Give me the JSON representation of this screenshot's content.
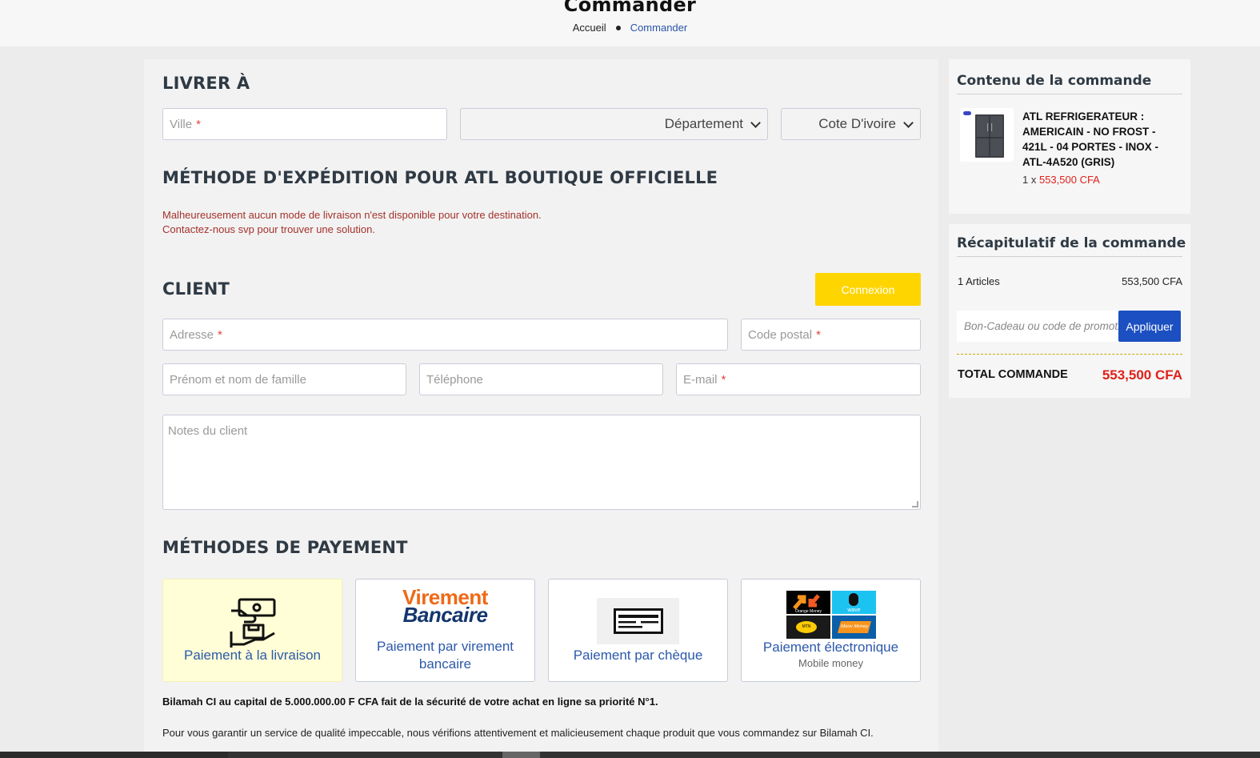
{
  "page": {
    "title": "Commander",
    "breadcrumb": {
      "home": "Accueil",
      "current": "Commander"
    }
  },
  "ship_to": {
    "heading": "LIVRER À",
    "city_placeholder": "Ville",
    "required_mark": "*",
    "department_value": "Département",
    "country_value": "Cote D'ivoire"
  },
  "shipping_method": {
    "heading": "MÉTHODE D'EXPÉDITION POUR ATL BOUTIQUE OFFICIELLE",
    "warning_line1": "Malheureusement aucun mode de livraison n'est disponible pour votre destination.",
    "warning_line2": "Contactez-nous svp pour trouver une solution."
  },
  "client": {
    "heading": "CLIENT",
    "login_label": "Connexion",
    "address_placeholder": "Adresse",
    "postal_placeholder": "Code postal",
    "name_placeholder": "Prénom et nom de famille",
    "phone_placeholder": "Téléphone",
    "email_placeholder": "E-mail",
    "notes_placeholder": "Notes du client"
  },
  "payment": {
    "heading": "MÉTHODES DE PAYEMENT",
    "methods": [
      {
        "label": "Paiement à la livraison",
        "icon": "cash-on-delivery-icon",
        "selected": true
      },
      {
        "label": "Paiement par virement bancaire",
        "logo_line1": "Virement",
        "logo_line2": "Bancaire",
        "icon": "bank-transfer-logo"
      },
      {
        "label": "Paiement par chèque",
        "icon": "cheque-icon"
      },
      {
        "label": "Paiement électronique",
        "sub": "Mobile money",
        "icon": "mobile-money-logo",
        "logo_tiles": [
          "Orange Money",
          "wave",
          "MTN",
          "Moov Money"
        ]
      }
    ]
  },
  "legal": {
    "bold": "Bilamah CI au capital de 5.000.000.00 F CFA fait de la sécurité de votre achat en ligne sa priorité N°1.",
    "text": "Pour vous garantir un service de qualité impeccable, nous vérifions attentivement et malicieusement chaque produit que vous commandez sur Bilamah CI."
  },
  "order_content": {
    "heading": "Contenu de la commande",
    "product_name": "ATL REFRIGERATEUR : AMERICAIN - NO FROST - 421L - 04 PORTES - INOX - ATL-4A520 (GRIS)",
    "qty_prefix": "1 x",
    "price": "553,500 CFA"
  },
  "summary": {
    "heading": "Récapitulatif de la commande",
    "items_label": "1 Articles",
    "items_value": "553,500 CFA",
    "promo_placeholder": "Bon-Cadeau ou code de promotion",
    "apply_label": "Appliquer",
    "total_label": "TOTAL COMMANDE",
    "total_value": "553,500 CFA"
  },
  "colors": {
    "accent_yellow": "#ffd500",
    "link_blue": "#2c59ab",
    "button_blue": "#1c4fc1",
    "price_red": "#e0211b",
    "warning_red": "#a4322b"
  }
}
